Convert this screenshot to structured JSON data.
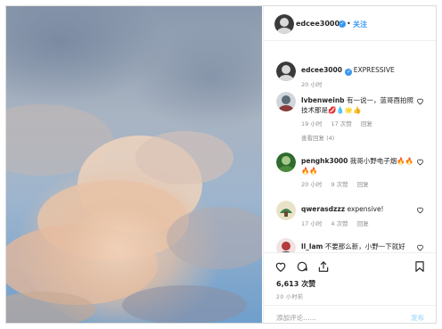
{
  "header": {
    "username": "edcee3000",
    "separator": "•",
    "follow_label": "关注"
  },
  "caption": {
    "username": "edcee3000",
    "text": "EXPRESSIVE",
    "time": "20 小时"
  },
  "comments": [
    {
      "username": "lvbenweinb",
      "text": "有一说一，蓝哥酉拍照技术那是💋💧🌟👍",
      "time": "19 小时",
      "likes": "17 次赞",
      "reply": "回复",
      "view_replies": "查看回复 (4)"
    },
    {
      "username": "penghk3000",
      "text": "我哥小野电子烟🔥🔥🔥🔥",
      "time": "20 小时",
      "likes": "9 次赞",
      "reply": "回复"
    },
    {
      "username": "qwerasdzzz",
      "text": "expensive!",
      "time": "17 小时",
      "likes": "4 次赞",
      "reply": "回复"
    },
    {
      "username": "ll_lam",
      "text": "不要那么新，小野一下就好",
      "time": "",
      "likes": "",
      "reply": ""
    }
  ],
  "actions": {
    "likes": "6,613 次赞",
    "timestamp": "20 小时前"
  },
  "add_comment": {
    "placeholder": "添加评论……",
    "post_label": "发布"
  },
  "colors": {
    "accent": "#3897f0",
    "muted": "#8e8e8e",
    "border": "#dbdbdb"
  },
  "icons": [
    "heart-icon",
    "comment-icon",
    "share-icon",
    "bookmark-icon",
    "verified-icon"
  ]
}
